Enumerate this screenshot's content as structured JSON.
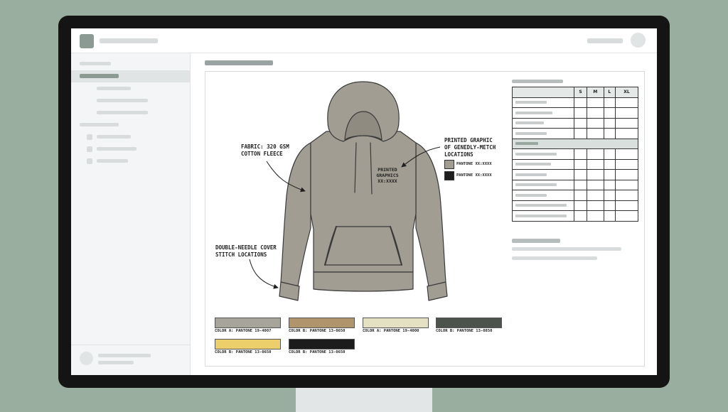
{
  "annotations": {
    "fabric": [
      "FABRIC: 320 GSM",
      "COTTON FLEECE"
    ],
    "stitch": [
      "DOUBLE-NEEDLE COVER",
      "STITCH LOCATIONS"
    ],
    "graphic": [
      "PRINTED GRAPHIC",
      "OF GENEDLY-METCH",
      "LOCATIONS"
    ],
    "print_label": [
      "PRINTED",
      "GRAPHICS",
      "XX:XXXX"
    ]
  },
  "pantones": [
    {
      "label": "PANTONE XX:XXXX",
      "color": "#a19d92"
    },
    {
      "label": "PANTONE XX:XXXX",
      "color": "#1f1f1f"
    }
  ],
  "spec_table": {
    "sizes": [
      "S",
      "M",
      "L",
      "XL"
    ]
  },
  "colorways": [
    {
      "label": "COLOR A: PANTONE 19-4007",
      "color": "#a7a59b"
    },
    {
      "label": "COLOR B: PANTONE 13-0650",
      "color": "#b0946c"
    },
    {
      "label": "COLOR A: PANTONE 19-4000",
      "color": "#e4e0c2"
    },
    {
      "label": "COLOR B: PANTONE 13-0850",
      "color": "#4c534c"
    },
    {
      "label": "COLOR B: PANTONE 13-0650",
      "color": "#ecce6a"
    },
    {
      "label": "COLOR B: PANTONE 13-0650",
      "color": "#1c1c1c"
    }
  ],
  "colors": {
    "hoodie": "#a19d92",
    "outline": "#3a3a3a",
    "background": "#9aae9f"
  }
}
